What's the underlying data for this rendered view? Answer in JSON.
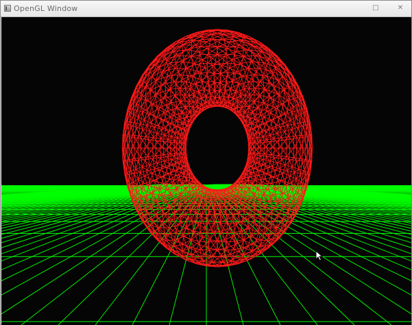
{
  "window": {
    "title": "OpenGL Window",
    "maximize_symbol": "□",
    "close_symbol": "✕"
  },
  "scene": {
    "background_color": "#050505",
    "grid_color": "#00ff00",
    "torus_color": "#ff1a1a"
  },
  "icons": {
    "app": "window-app-icon",
    "maximize": "maximize-icon",
    "close": "close-icon",
    "cursor": "mouse-cursor-icon"
  }
}
